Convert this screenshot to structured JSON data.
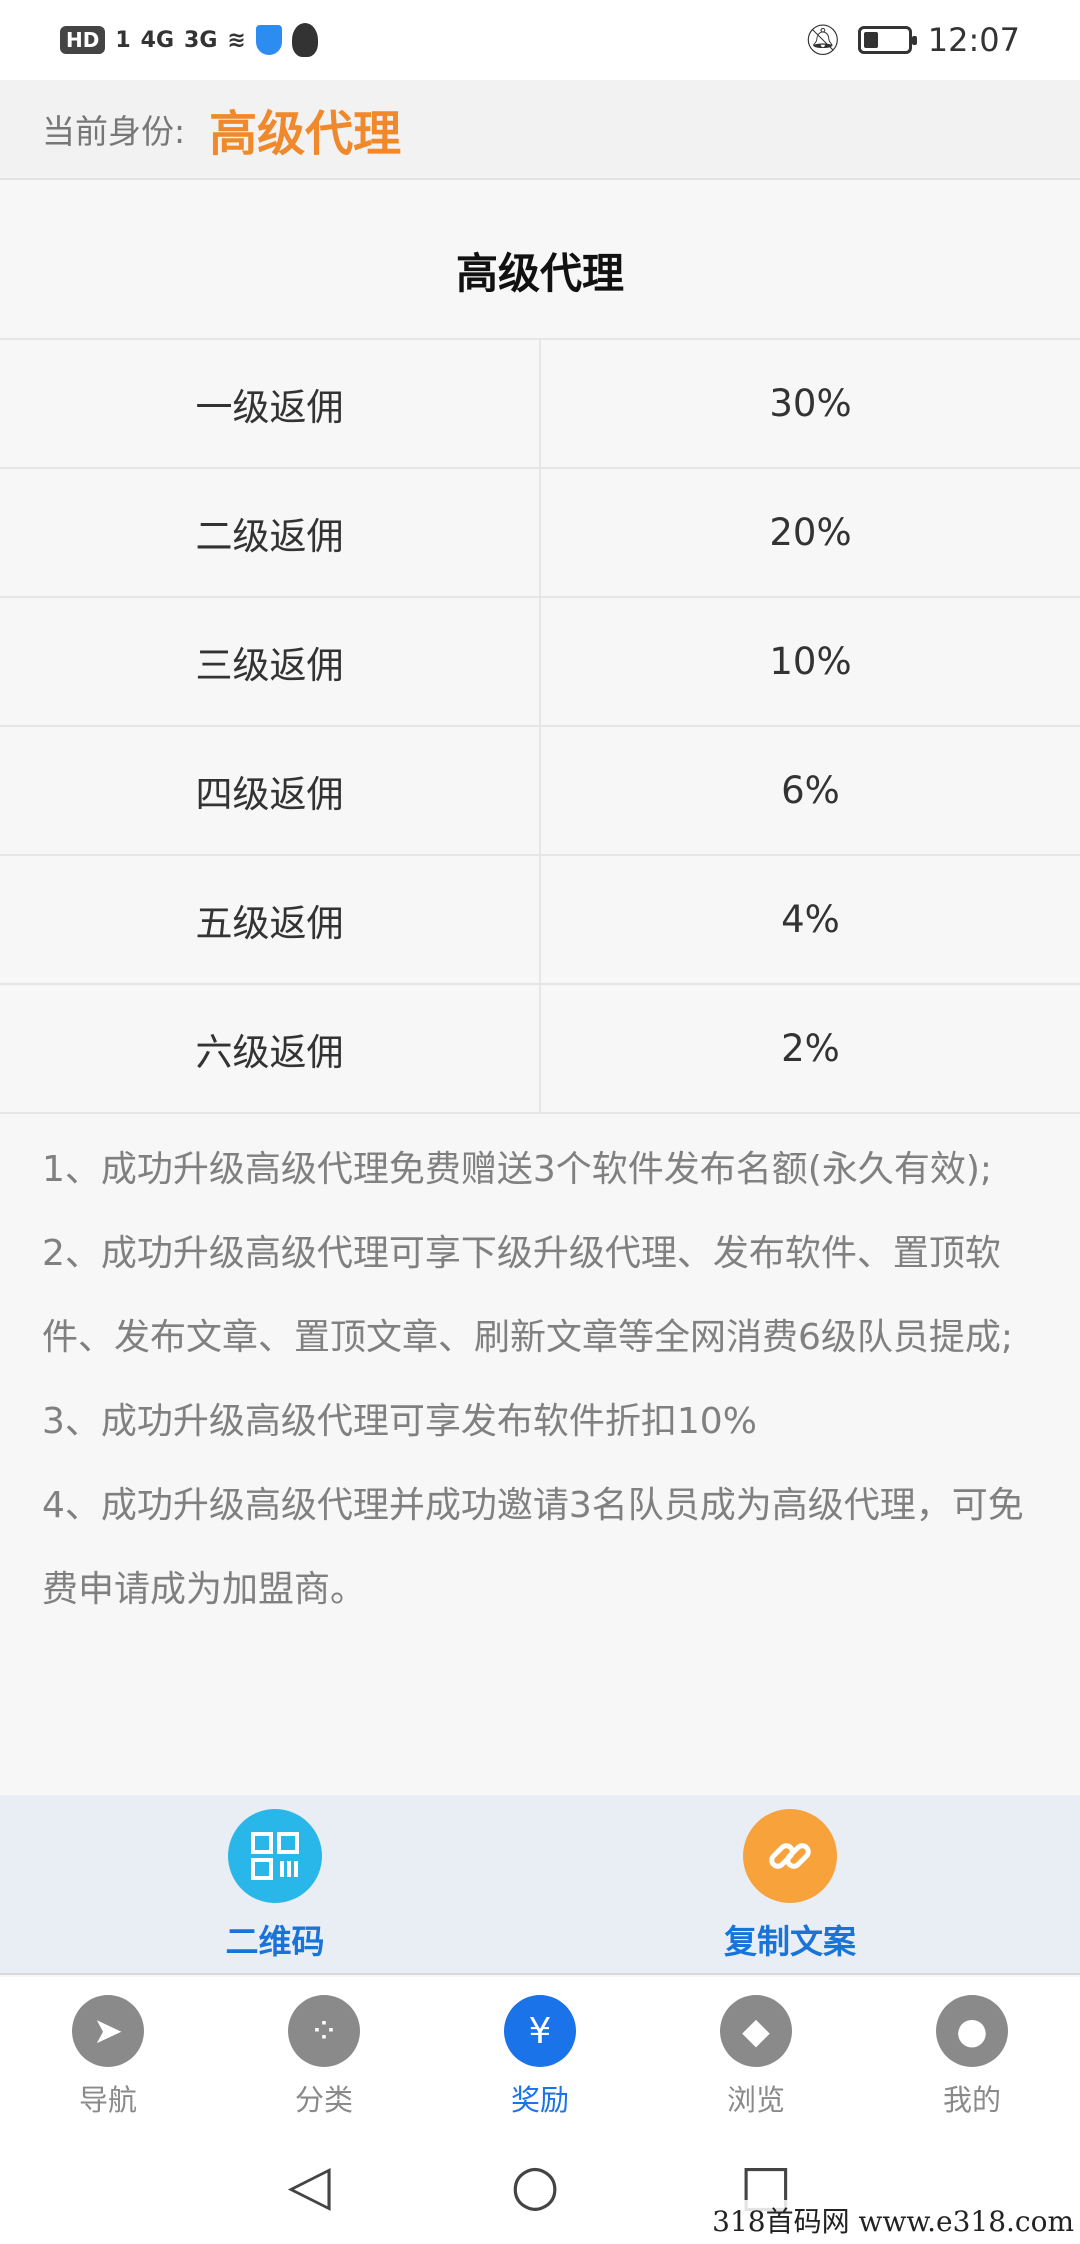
{
  "status_bar": {
    "hd": "HD",
    "sim": "1",
    "net1": "4G",
    "net2": "3G",
    "time": "12:07"
  },
  "identity": {
    "label": "当前身份:",
    "value": "高级代理"
  },
  "table": {
    "title": "高级代理",
    "rows": [
      {
        "level": "一级返佣",
        "rate": "30%"
      },
      {
        "level": "二级返佣",
        "rate": "20%"
      },
      {
        "level": "三级返佣",
        "rate": "10%"
      },
      {
        "level": "四级返佣",
        "rate": "6%"
      },
      {
        "level": "五级返佣",
        "rate": "4%"
      },
      {
        "level": "六级返佣",
        "rate": "2%"
      }
    ]
  },
  "notes": [
    "1、成功升级高级代理免费赠送3个软件发布名额(永久有效);",
    "2、成功升级高级代理可享下级升级代理、发布软件、置顶软件、发布文章、置顶文章、刷新文章等全网消费6级队员提成;",
    "3、成功升级高级代理可享发布软件折扣10%",
    "4、成功升级高级代理并成功邀请3名队员成为高级代理，可免费申请成为加盟商。"
  ],
  "actions": {
    "qrcode_label": "二维码",
    "copy_label": "复制文案",
    "qrcode_color": "#29b6e8",
    "copy_color": "#f7a23b"
  },
  "tabs": [
    {
      "label": "导航",
      "icon": "navigation-icon",
      "glyph": "➤"
    },
    {
      "label": "分类",
      "icon": "category-icon",
      "glyph": "⁘"
    },
    {
      "label": "奖励",
      "icon": "reward-icon",
      "glyph": "¥"
    },
    {
      "label": "浏览",
      "icon": "compass-icon",
      "glyph": "◆"
    },
    {
      "label": "我的",
      "icon": "profile-icon",
      "glyph": "●"
    }
  ],
  "active_tab": "奖励",
  "watermark": "318首码网  www.e318.com"
}
